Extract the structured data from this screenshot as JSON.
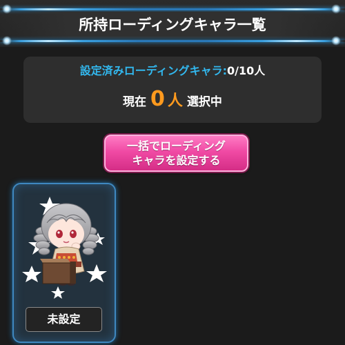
{
  "header": {
    "title": "所持ローディングキャラ一覧"
  },
  "status": {
    "set_label": "設定済みローディングキャラ:",
    "set_count": "0/10人",
    "selection_prefix": "現在",
    "selection_count": "0",
    "selection_unit": "人",
    "selection_suffix": "選択中"
  },
  "bulk_button": {
    "line1": "一括でローディング",
    "line2": "キャラを設定する"
  },
  "cards": [
    {
      "status_label": "未設定"
    }
  ],
  "colors": {
    "accent_cyan": "#32b8ef",
    "count_orange": "#ff9a1e",
    "button_pink": "#f04aa4",
    "card_border": "#3f88c0"
  }
}
